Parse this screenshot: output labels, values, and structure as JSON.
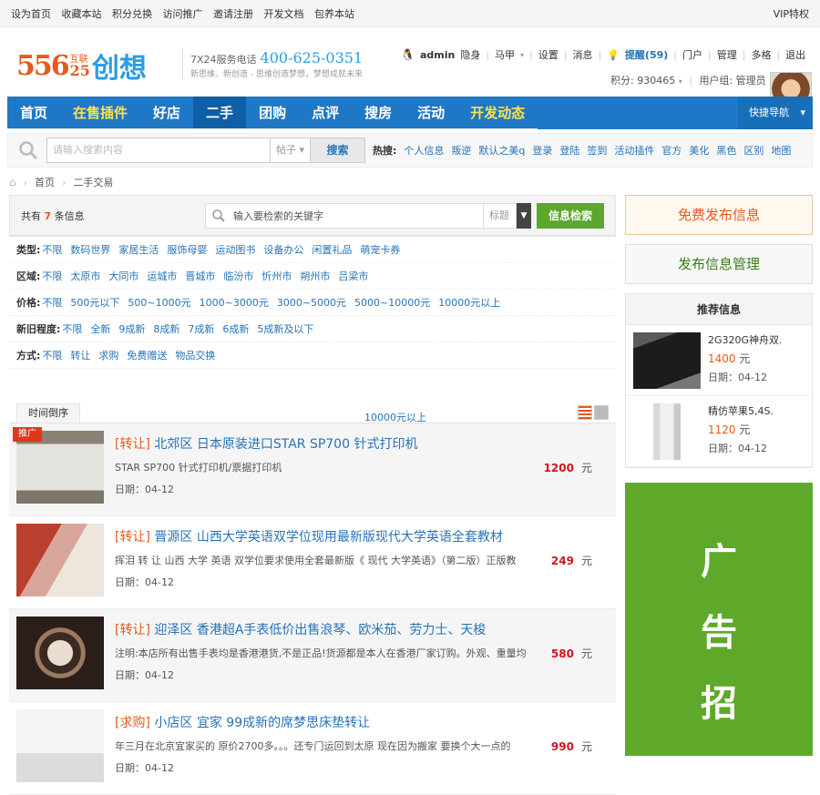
{
  "topbar": {
    "links": [
      "设为首页",
      "收藏本站",
      "积分兑换",
      "访问推广",
      "邀请注册",
      "开发文档",
      "包养本站"
    ],
    "vip": "VIP特权"
  },
  "logo": {
    "num_a": "556",
    "num_b": "25",
    "hu_1": "互联",
    "hu_2": "",
    "brand": "创想"
  },
  "slogan": {
    "service": "7X24服务电话",
    "phone": "400-625-0351",
    "tag": "新思维、新创造 - 思维创造梦想，梦想成就未来"
  },
  "user": {
    "name": "admin",
    "hide": "隐身",
    "mj": "马甲",
    "settings": "设置",
    "msg": "消息",
    "remind": "提醒(59)",
    "portal": "门户",
    "manage": "管理",
    "multi": "多格",
    "logout": "退出",
    "points": "积分: 930465",
    "group": "用户组: 管理员"
  },
  "nav": {
    "items": [
      {
        "label": "首页",
        "hl": false
      },
      {
        "label": "在售插件",
        "hl": true
      },
      {
        "label": "好店",
        "hl": false
      },
      {
        "label": "二手",
        "hl": false
      },
      {
        "label": "团购",
        "hl": false
      },
      {
        "label": "点评",
        "hl": false
      },
      {
        "label": "搜房",
        "hl": false
      },
      {
        "label": "活动",
        "hl": false
      },
      {
        "label": "开发动态",
        "hl": true
      }
    ],
    "quick": "快捷导航"
  },
  "search": {
    "placeholder": "请输入搜索内容",
    "type": "帖子",
    "button": "搜索",
    "hot_label": "热搜:",
    "hot": [
      "个人信息",
      "叛逆",
      "默认之美q",
      "登录",
      "登陆",
      "签到",
      "活动插件",
      "官方",
      "美化",
      "黑色",
      "区别",
      "地图"
    ]
  },
  "breadcrumb": {
    "home": "首页",
    "current": "二手交易"
  },
  "filter": {
    "count_pre": "共有",
    "count": "7",
    "count_post": "条信息",
    "search_placeholder": "输入要检索的关键字",
    "field": "标题",
    "go": "信息检索",
    "rows": [
      {
        "label": "类型:",
        "options": [
          "不限",
          "数码世界",
          "家居生活",
          "服饰母婴",
          "运动图书",
          "设备办公",
          "闲置礼品",
          "萌宠卡券"
        ]
      },
      {
        "label": "区域:",
        "options": [
          "不限",
          "太原市",
          "大同市",
          "运城市",
          "晋城市",
          "临汾市",
          "忻州市",
          "朔州市",
          "吕梁市"
        ]
      },
      {
        "label": "价格:",
        "options": [
          "不限",
          "500元以下",
          "500~1000元",
          "1000~3000元",
          "3000~5000元",
          "5000~10000元",
          "10000元以上"
        ]
      },
      {
        "label": "新旧程度:",
        "options": [
          "不限",
          "全新",
          "9成新",
          "8成新",
          "7成新",
          "6成新",
          "5成新及以下"
        ]
      },
      {
        "label": "方式:",
        "options": [
          "不限",
          "转让",
          "求购",
          "免费赠送",
          "物品交换"
        ]
      }
    ],
    "tooltip": "10000元以上",
    "sort": "时间倒序"
  },
  "listings": [
    {
      "type": "[转让]",
      "title": "北郊区 日本原装进口STAR SP700 针式打印机",
      "desc": "STAR SP700 针式打印机/票据打印机",
      "date": "日期：04-12",
      "price": "1200",
      "unit": "元",
      "tag": "推广"
    },
    {
      "type": "[转让]",
      "title": "晋源区 山西大学英语双学位现用最新版现代大学英语全套教材",
      "desc": "挥泪 转 让 山西 大学 英语 双学位要求使用全套最新版《 现代 大学英语》（第二版）正版教",
      "date": "日期：04-12",
      "price": "249",
      "unit": "元",
      "tag": ""
    },
    {
      "type": "[转让]",
      "title": "迎泽区 香港超A手表低价出售浪琴、欧米茄、劳力士、天梭",
      "desc": "注明:本店所有出售手表均是香港港货,不是正品!货源都是本人在香港厂家订购。外观、重量均",
      "date": "日期：04-12",
      "price": "580",
      "unit": "元",
      "tag": ""
    },
    {
      "type": "[求购]",
      "title": "小店区 宜家 99成新的席梦思床垫转让",
      "desc": "年三月在北京宜家买的 原价2700多。。。还专门运回到太原 现在因为搬家 要换个大一点的",
      "date": "日期：04-12",
      "price": "990",
      "unit": "元",
      "tag": ""
    }
  ],
  "side": {
    "publish": "免费发布信息",
    "manage": "发布信息管理",
    "rec_title": "推荐信息",
    "rec": [
      {
        "title": "2G320G神舟双.",
        "price": "1400",
        "unit": "元",
        "date": "日期：04-12"
      },
      {
        "title": "精仿苹果5,4S.",
        "price": "1120",
        "unit": "元",
        "date": "日期：04-12"
      }
    ],
    "ad": [
      "广",
      "告",
      "招"
    ]
  }
}
